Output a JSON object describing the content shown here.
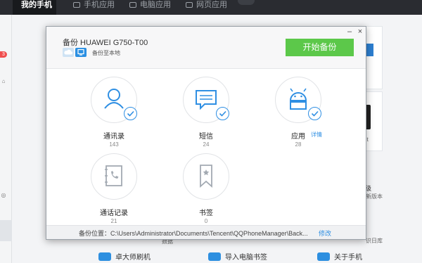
{
  "app": {
    "tabs": [
      {
        "label": "我的手机"
      },
      {
        "label": "手机应用"
      },
      {
        "label": "电脑应用"
      },
      {
        "label": "网页应用"
      }
    ],
    "badge": "3",
    "bg_texts": [
      "级",
      "新版本",
      "ot",
      "数据",
      "识日库"
    ],
    "bottom_tools": [
      {
        "label": "卓大师刷机"
      },
      {
        "label": "导入电脑书签"
      },
      {
        "label": "关于手机"
      }
    ]
  },
  "dialog": {
    "title": "备份 HUAWEI G750-T00",
    "target_label": "备份至本地",
    "start_button": "开始备份",
    "minimize": "–",
    "close": "×",
    "items": [
      {
        "label": "通讯录",
        "count": "143",
        "icon": "contacts-icon",
        "checked": true
      },
      {
        "label": "短信",
        "count": "24",
        "icon": "sms-icon",
        "checked": true
      },
      {
        "label": "应用",
        "count": "28",
        "icon": "android-icon",
        "checked": true,
        "link": "详情"
      },
      {
        "label": "通话记录",
        "count": "21",
        "icon": "call-log-icon",
        "checked": false
      },
      {
        "label": "书签",
        "count": "0",
        "icon": "bookmark-icon",
        "checked": false
      }
    ],
    "footer": {
      "path_label": "备份位置：C:\\Users\\Administrator\\Documents\\Tencent\\QQPhoneManager\\Back...",
      "edit_link": "修改"
    }
  },
  "colors": {
    "accent_blue": "#2f8fe3",
    "start_green": "#5cc84a",
    "icon_gray": "#a3aab2"
  }
}
